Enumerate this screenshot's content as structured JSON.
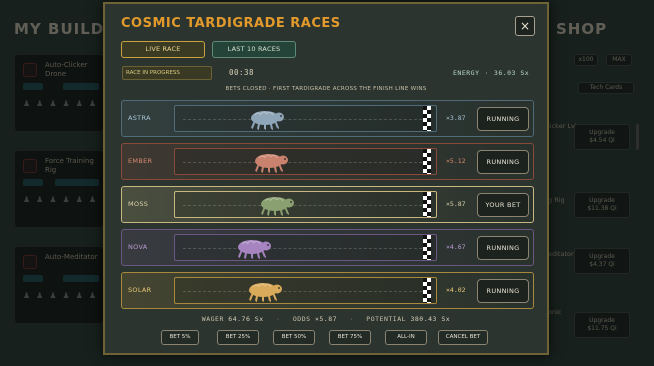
{
  "background": {
    "left_title": "MY BUILDIN",
    "right_title": "SHOP",
    "cards": [
      {
        "name": "Auto-Clicker Drone"
      },
      {
        "name": "Force Training Rig"
      },
      {
        "name": "Auto-Meditator"
      }
    ],
    "shop_top_buttons": [
      "x100",
      "MAX"
    ],
    "shop_tech_cards": "Tech Cards",
    "shop_items": [
      {
        "label": "licker\nLvl",
        "upgrade": "Upgrade\n$4.54 Qi"
      },
      {
        "label": "g Rig",
        "upgrade": "Upgrade\n$11.38 Qi"
      },
      {
        "label": "editator",
        "upgrade": "Upgrade\n$4.37 Qi"
      },
      {
        "label": "onic",
        "upgrade": "Upgrade\n$11.75 Qi"
      }
    ]
  },
  "modal": {
    "title": "COSMIC TARDIGRADE RACES",
    "close_label": "×",
    "tabs": {
      "live": "LIVE RACE",
      "last": "LAST 10 RACES"
    },
    "status": "RACE IN PROGRESS",
    "timer": "00:38",
    "energy_label": "ENERGY",
    "energy_value": "36.03 Sx",
    "bets_closed": "BETS CLOSED · FIRST TARDIGRADE ACROSS THE FINISH LINE WINS",
    "racers": [
      {
        "name": "ASTRA",
        "odds": "×3.87",
        "button": "RUNNING",
        "progress": 0.3,
        "color": "#8fa6b8",
        "border": "#4f6a78",
        "text": "#a6c4d6"
      },
      {
        "name": "EMBER",
        "odds": "×5.12",
        "button": "RUNNING",
        "progress": 0.32,
        "color": "#c8826e",
        "border": "#8a4a3a",
        "text": "#d88a6e"
      },
      {
        "name": "MOSS",
        "odds": "×5.87",
        "button": "YOUR BET",
        "progress": 0.35,
        "color": "#8aa070",
        "border": "#c8b880",
        "text": "#d8d0a8"
      },
      {
        "name": "NOVA",
        "odds": "×4.67",
        "button": "RUNNING",
        "progress": 0.24,
        "color": "#a684c0",
        "border": "#6c5684",
        "text": "#b89ad0"
      },
      {
        "name": "SOLAR",
        "odds": "×4.02",
        "button": "RUNNING",
        "progress": 0.29,
        "color": "#d8aa5a",
        "border": "#a8883a",
        "text": "#e8c878"
      }
    ],
    "summary": {
      "wager_label": "WAGER",
      "wager": "64.76 Sx",
      "odds_label": "ODDS",
      "odds": "×5.87",
      "potential_label": "POTENTIAL",
      "potential": "380.43 Sx"
    },
    "bet_buttons": [
      "BET 5%",
      "BET 25%",
      "BET 50%",
      "BET 75%",
      "ALL-IN",
      "CANCEL BET"
    ]
  }
}
